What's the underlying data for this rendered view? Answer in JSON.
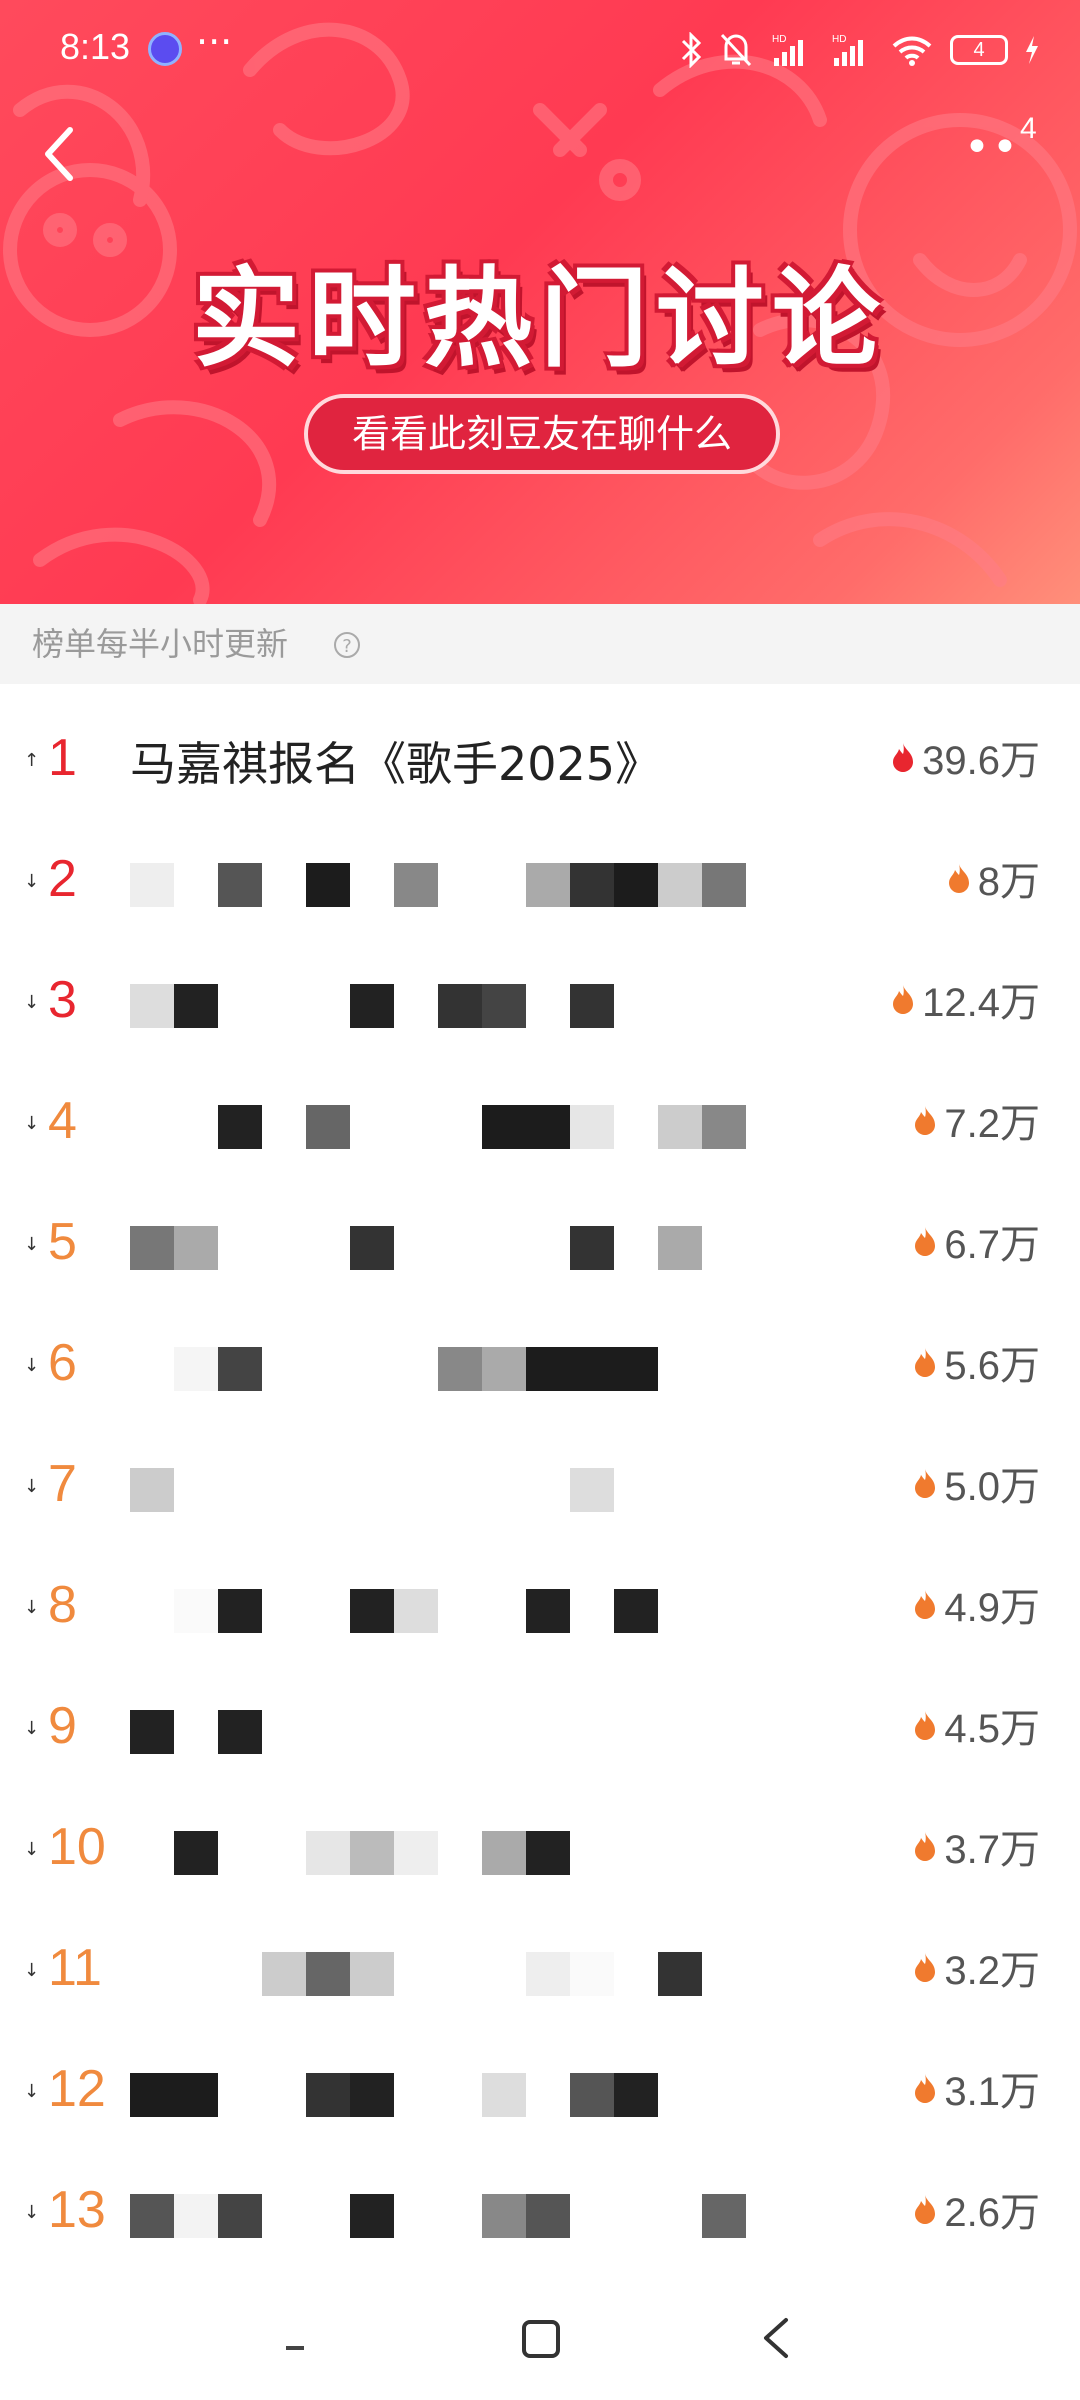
{
  "status": {
    "time": "8:13",
    "more": "···",
    "battery": "4"
  },
  "header": {
    "more_badge": "4",
    "title": "实时热门讨论",
    "subtitle": "看看此刻豆友在聊什么"
  },
  "notice": {
    "text": "榜单每半小时更新",
    "icon": "?"
  },
  "list": [
    {
      "rank": "1",
      "title": "马嘉祺报名《歌手2025》",
      "heat": "39.6万"
    },
    {
      "rank": "2",
      "title": "",
      "heat": "8万"
    },
    {
      "rank": "3",
      "title": "",
      "heat": "12.4万"
    },
    {
      "rank": "4",
      "title": "",
      "heat": "7.2万"
    },
    {
      "rank": "5",
      "title": "",
      "heat": "6.7万"
    },
    {
      "rank": "6",
      "title": "",
      "heat": "5.6万"
    },
    {
      "rank": "7",
      "title": "",
      "heat": "5.0万"
    },
    {
      "rank": "8",
      "title": "",
      "heat": "4.9万"
    },
    {
      "rank": "9",
      "title": "",
      "heat": "4.5万"
    },
    {
      "rank": "10",
      "title": "",
      "heat": "3.7万"
    },
    {
      "rank": "11",
      "title": "",
      "heat": "3.2万"
    },
    {
      "rank": "12",
      "title": "",
      "heat": "3.1万"
    },
    {
      "rank": "13",
      "title": "",
      "heat": "2.6万"
    }
  ],
  "colors": {
    "rank_top": "#e8262f",
    "rank_other": "#f08a3e",
    "flame_top": "#e8262f",
    "flame_other": "#f07a2e"
  }
}
